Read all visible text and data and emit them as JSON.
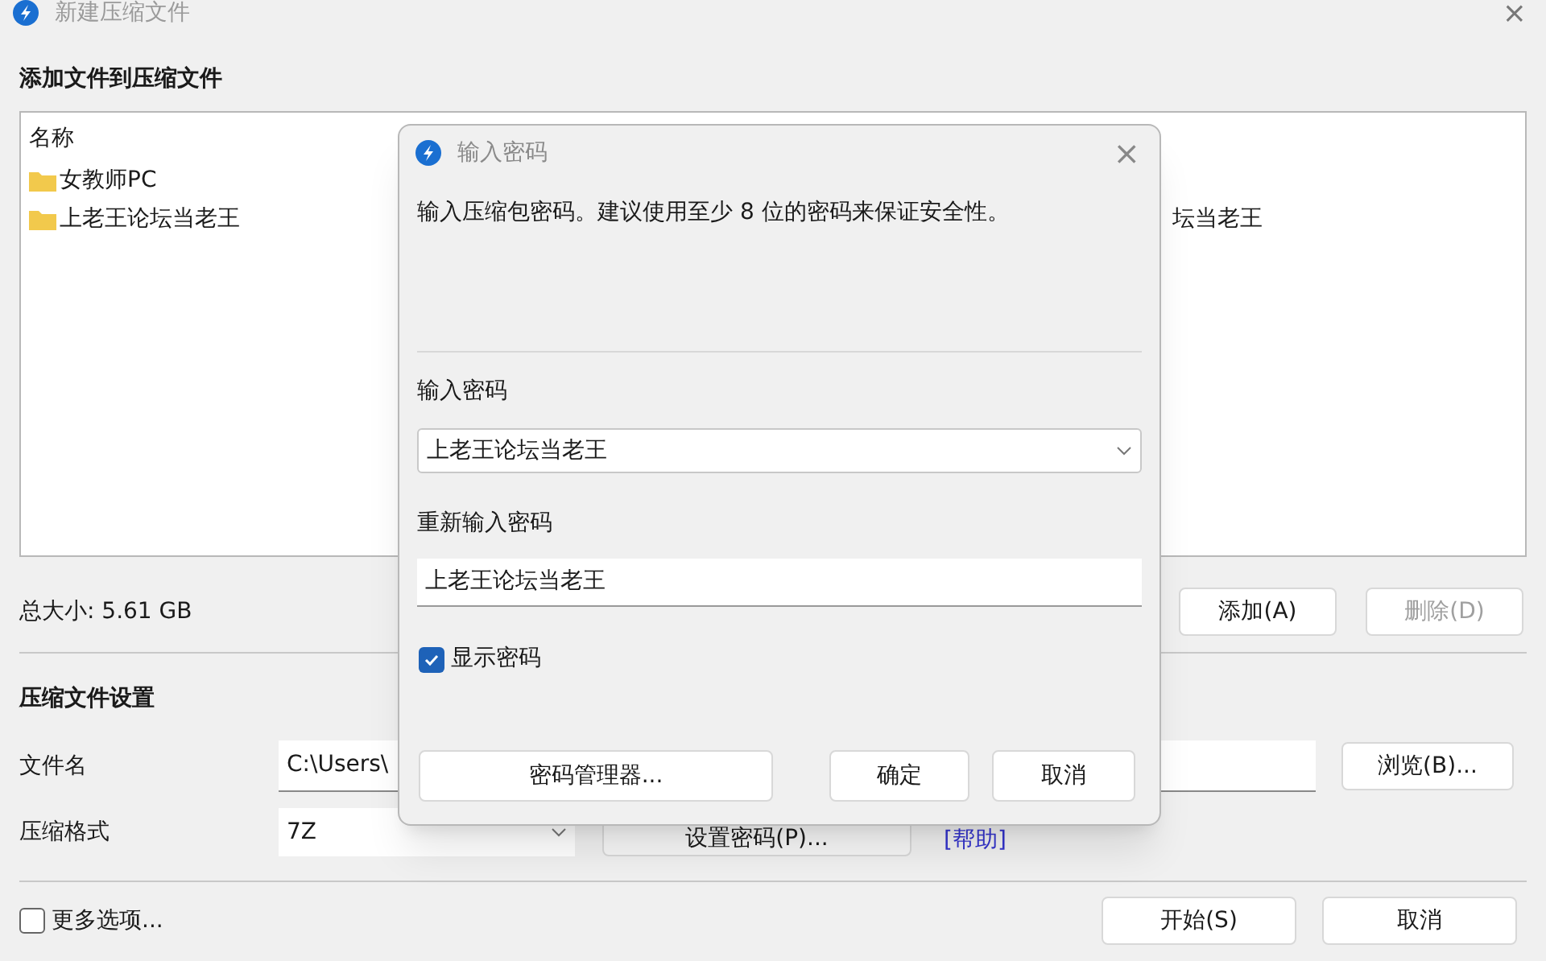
{
  "window": {
    "title": "新建压缩文件",
    "close": "×"
  },
  "add_section": {
    "heading": "添加文件到压缩文件",
    "list_header": "名称",
    "rows": [
      {
        "name": "女教师PC"
      },
      {
        "name": "上老王论坛当老王",
        "column_2": "坛当老王"
      }
    ],
    "total_size": "总大小: 5.61 GB",
    "buttons": [
      {
        "label": "添加(A)",
        "disabled": false
      },
      {
        "label": "删除(D)",
        "disabled": true
      }
    ]
  },
  "settings": {
    "heading": "压缩文件设置",
    "filename_label": "文件名",
    "filename_value": "C:\\Users\\",
    "browse_button": "浏览(B)...",
    "format_label": "压缩格式",
    "format_value": "7Z",
    "password_button": "设置密码(P)...",
    "help_link": "[帮助]"
  },
  "more_options": {
    "label": "更多选项...",
    "checked": false
  },
  "footer_buttons": [
    "开始(S)",
    "取消"
  ],
  "dialog": {
    "title": "输入密码",
    "close": "×",
    "message": "输入压缩包密码。建议使用至少 8 位的密码来保证安全性。",
    "password_label": "输入密码",
    "password_value": "上老王论坛当老王",
    "confirm_label": "重新输入密码",
    "confirm_value": "上老王论坛当老王",
    "show_password": {
      "label": "显示密码",
      "checked": true
    },
    "buttons": [
      "密码管理器...",
      "确定",
      "取消"
    ]
  }
}
